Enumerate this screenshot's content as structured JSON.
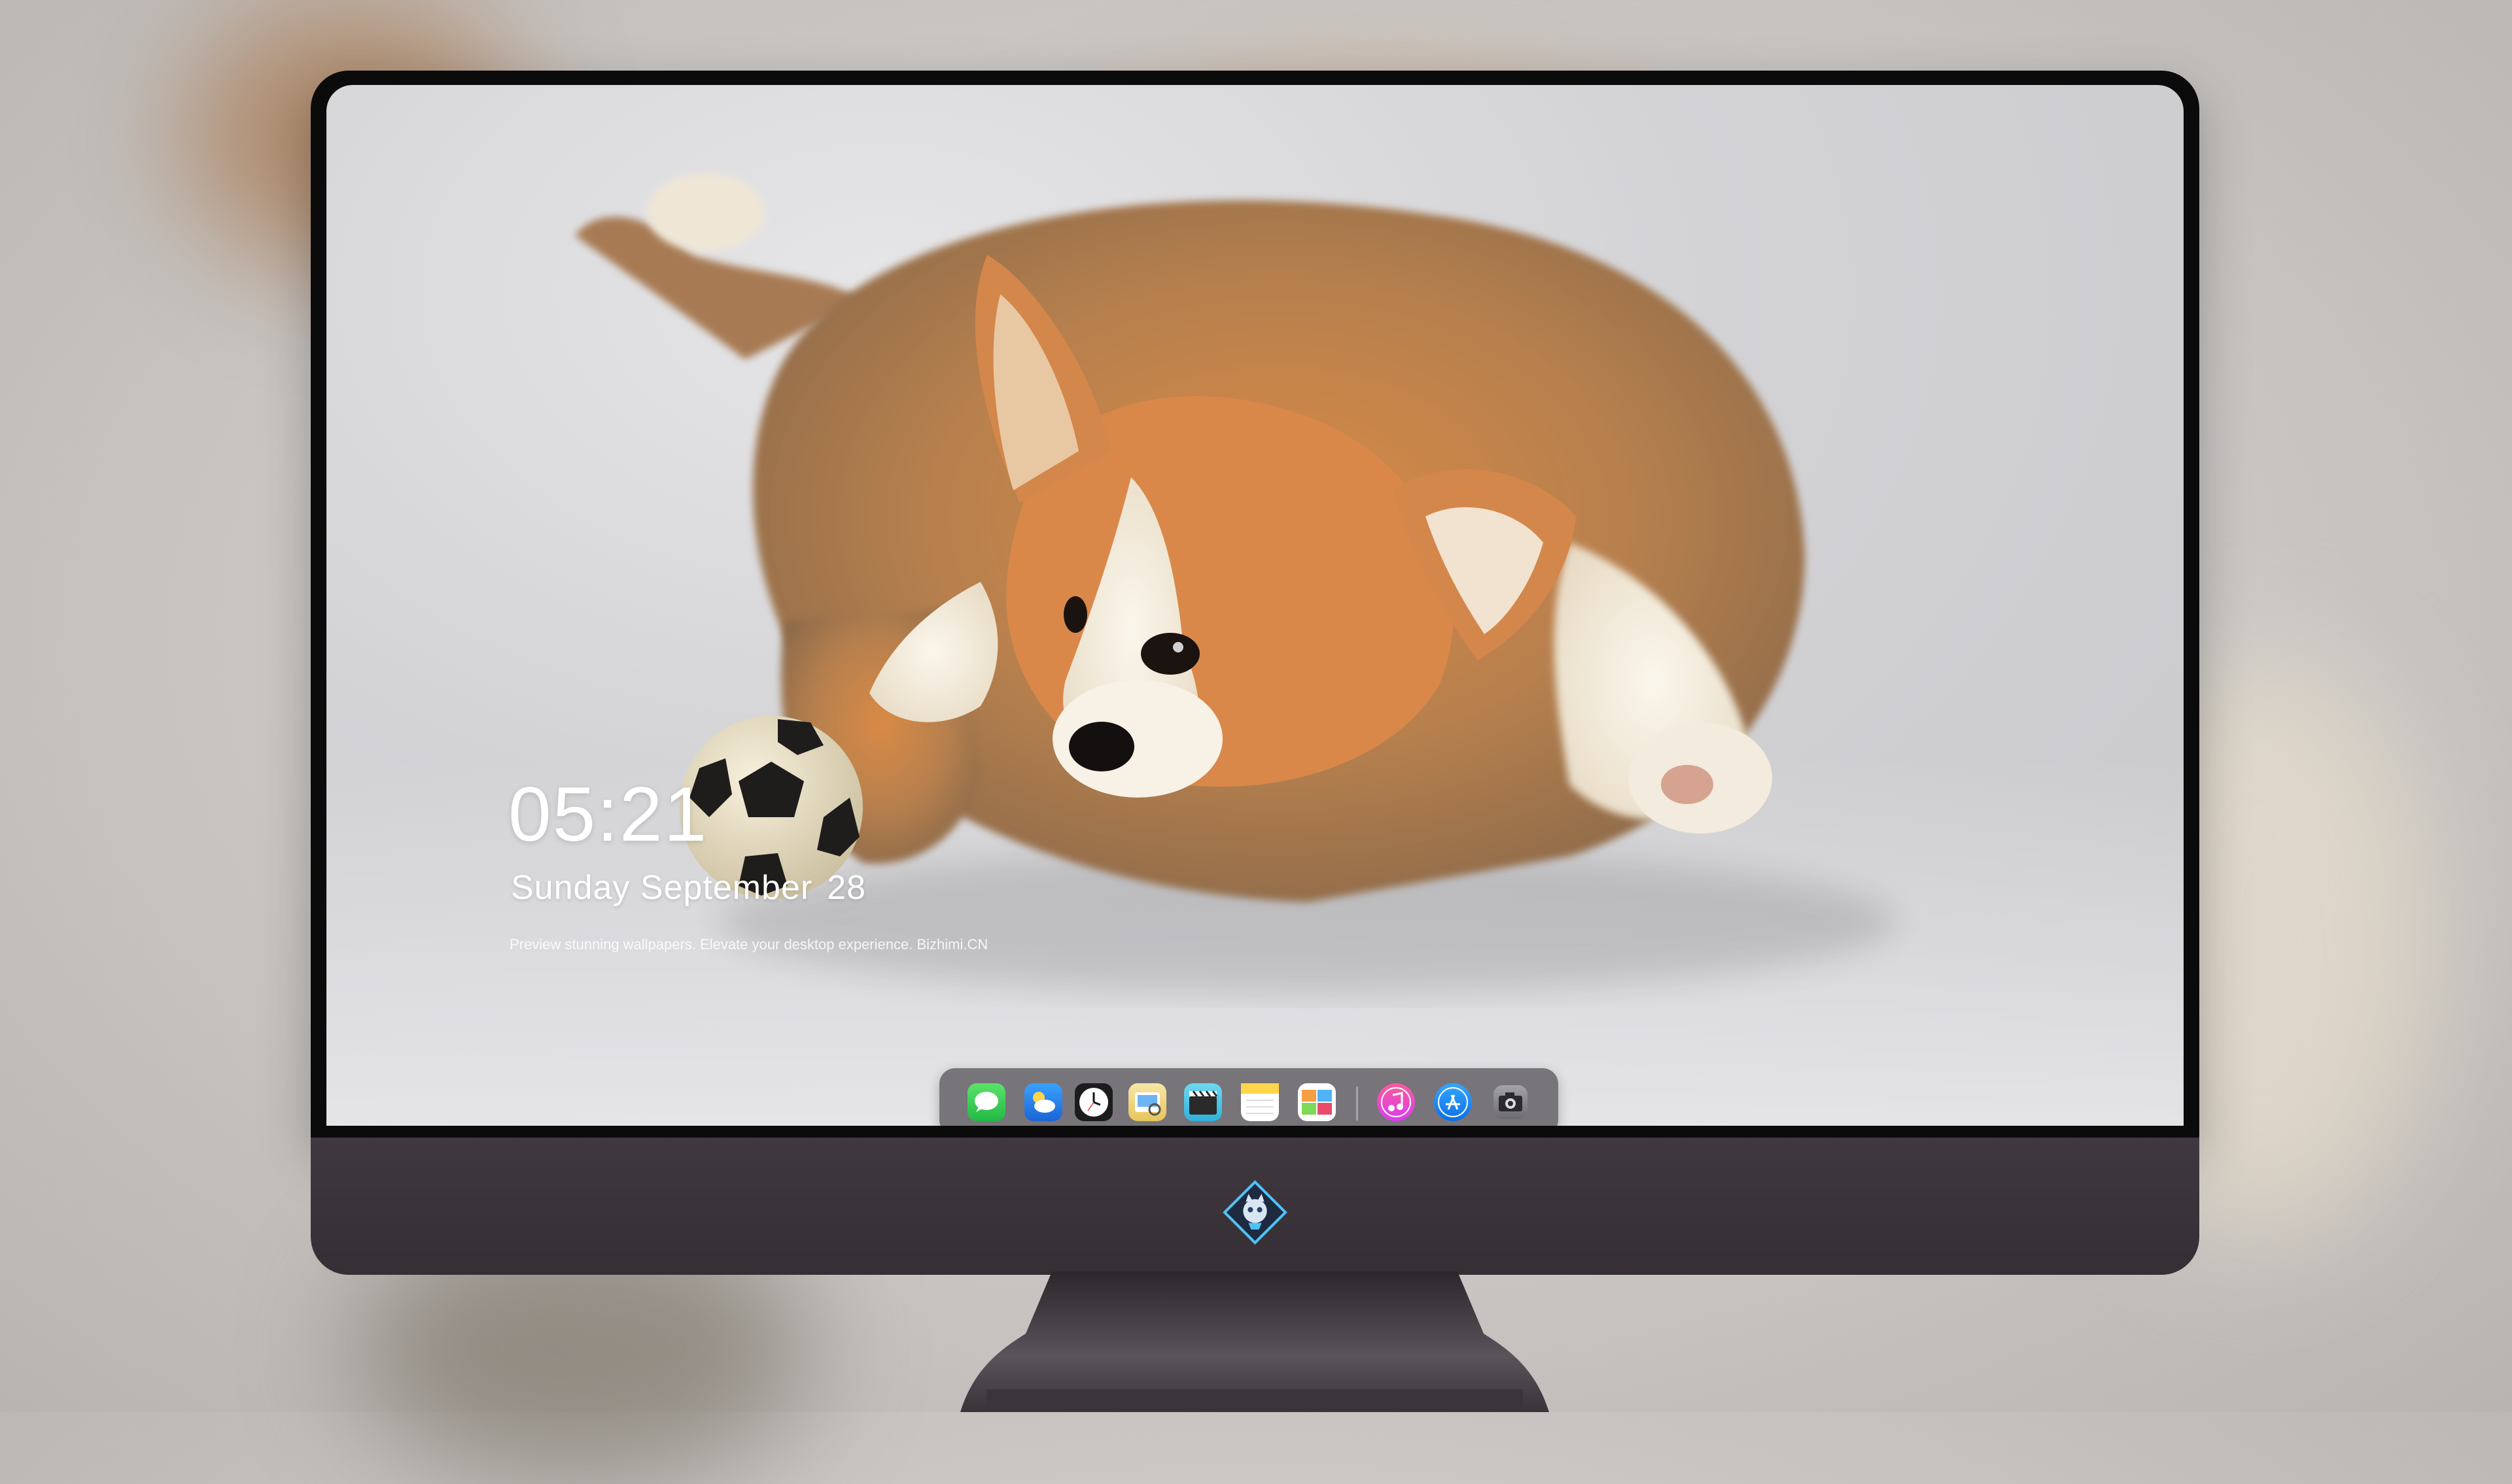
{
  "lock_screen": {
    "time": "05:21",
    "date_day": "Sunday",
    "date_month": "September",
    "date_num": "28",
    "tagline": "Preview stunning wallpapers. Elevate your desktop experience. Bizhimi.CN"
  },
  "dock": {
    "apps": [
      {
        "name": "Messages",
        "icon": "messages-icon",
        "color": "#2fd158"
      },
      {
        "name": "Weather",
        "icon": "weather-icon",
        "color": "#2c8cf0"
      },
      {
        "name": "Clock",
        "icon": "clock-icon",
        "color": "#1c1c1e"
      },
      {
        "name": "Preview",
        "icon": "preview-icon",
        "color": "#f2c94c"
      },
      {
        "name": "Clips",
        "icon": "clips-icon",
        "color": "#48c7e8"
      },
      {
        "name": "Notes",
        "icon": "notes-icon",
        "color": "#ffd54a"
      },
      {
        "name": "Photo Booth",
        "icon": "photo-booth-icon",
        "color": "#f59e42"
      },
      {
        "name": "Music",
        "icon": "music-icon",
        "color": "#fa3c7e"
      },
      {
        "name": "App Store",
        "icon": "app-store-icon",
        "color": "#1e8cff"
      },
      {
        "name": "Camera",
        "icon": "camera-icon",
        "color": "#8e8e93"
      }
    ]
  },
  "colors": {
    "bezel": "#0b0b0c",
    "chin": "#3f393f",
    "dock_bg": "#5f5c61"
  }
}
